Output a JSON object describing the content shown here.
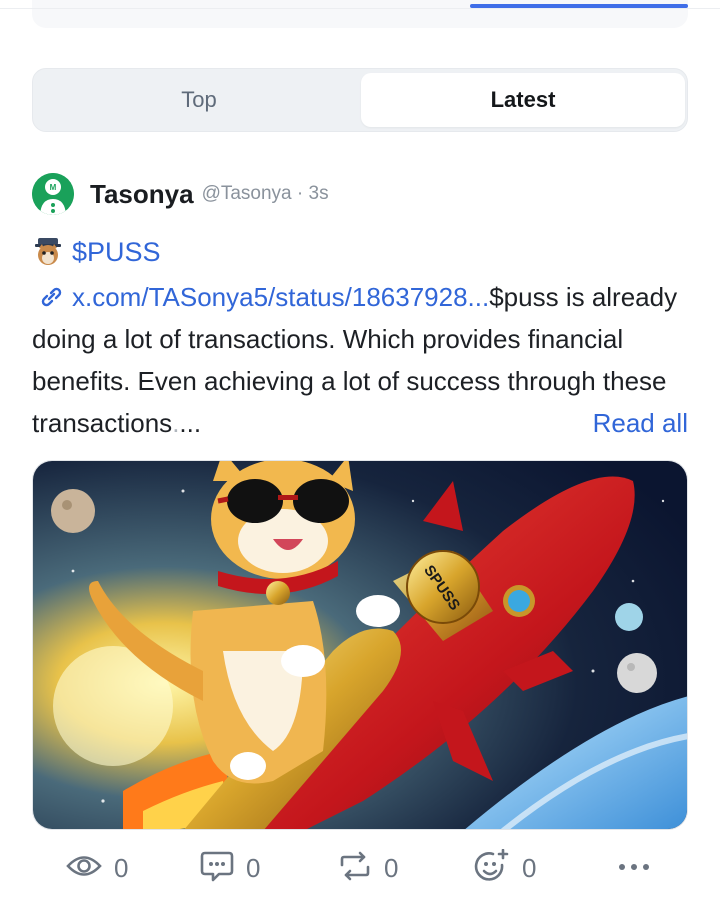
{
  "tabs": [
    {
      "label": "Top",
      "active": false
    },
    {
      "label": "Latest",
      "active": true
    }
  ],
  "post": {
    "author_name": "Tasonya",
    "author_handle": "@Tasonya · 3s",
    "ticker": "$PUSS",
    "link_text": "x.com/TASonya5/status/18637928...",
    "body_after_link": "$puss is already doing a lot of transactions. Which provides financial benefits. Even achieving a lot of success through these transactions",
    "faded_tail": ".",
    "ellipsis": "...",
    "read_all": "Read all",
    "image_badge_text": "SPUSS",
    "icons": {
      "avatar": "avatar-icon",
      "ticker_emoji": "puss-emoji-icon",
      "link": "link-icon",
      "views": "eye-icon",
      "comments": "comment-icon",
      "reposts": "repost-icon",
      "react": "add-reaction-icon",
      "more": "more-dots-icon"
    },
    "stats": {
      "views": "0",
      "comments": "0",
      "reposts": "0",
      "reactions": "0"
    }
  },
  "colors": {
    "accent": "#3f6ee8",
    "link": "#3166d8",
    "avatar_green": "#1aa15a"
  }
}
